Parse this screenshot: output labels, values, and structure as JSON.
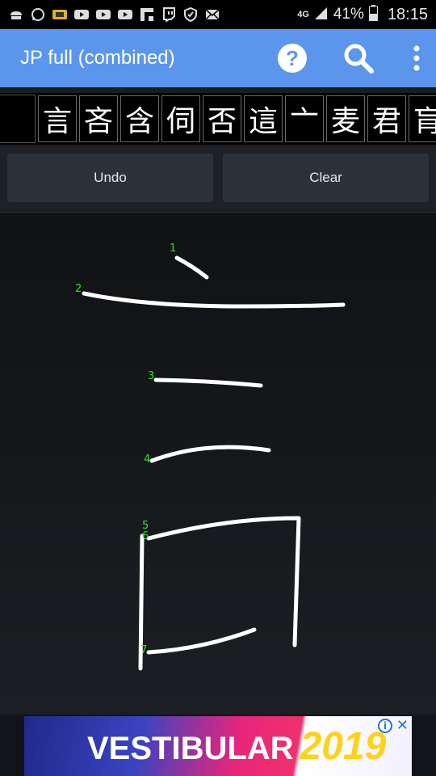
{
  "status_bar": {
    "network": "4G",
    "battery_percent": "41%",
    "time": "18:15",
    "left_icons": [
      "chef-hat-icon",
      "whatsapp-icon",
      "ticket-icon",
      "youtube-icon",
      "youtube-icon",
      "youtube-icon",
      "flipboard-icon",
      "twitch-icon",
      "shield-icon",
      "mail-icon"
    ]
  },
  "app_bar": {
    "title": "JP full (combined)",
    "color": "#5b96ec"
  },
  "candidates": [
    "言",
    "吝",
    "含",
    "伺",
    "否",
    "這",
    "亠",
    "麦",
    "君",
    "肓"
  ],
  "buttons": {
    "undo": "Undo",
    "clear": "Clear"
  },
  "canvas": {
    "stroke_numbers": [
      "1",
      "2",
      "3",
      "4",
      "5",
      "6",
      "7"
    ],
    "stroke_label_color": "#2ee02e"
  },
  "ad": {
    "headline": "VESTIBULAR",
    "year": "2019",
    "info_label": "i",
    "close_label": "✕"
  }
}
